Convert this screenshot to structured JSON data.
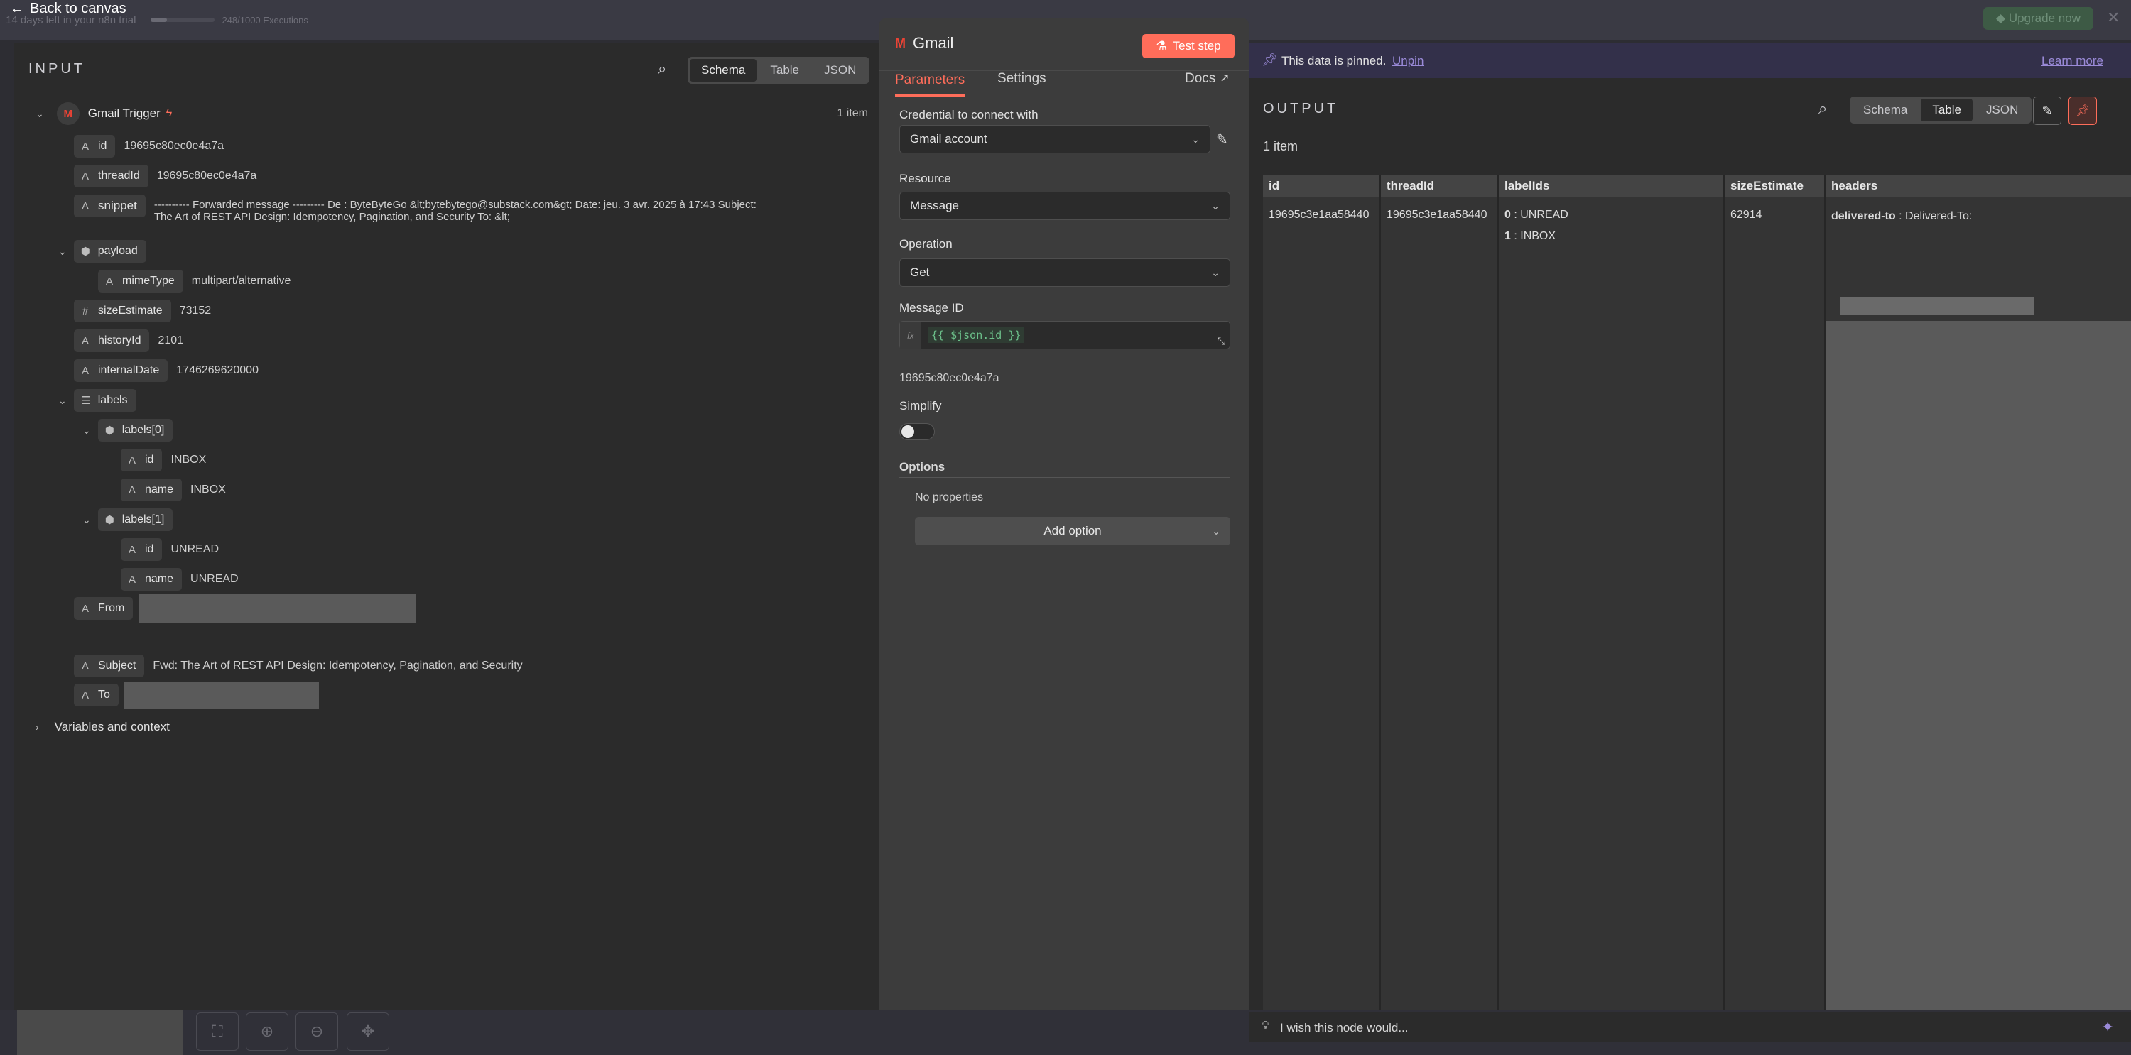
{
  "topbar": {
    "back_label": "Back to canvas",
    "trial_text": "14 days left in your n8n trial",
    "executions_text": "248/1000 Executions",
    "executions_progress": 0.248,
    "upgrade_label": "Upgrade now"
  },
  "input": {
    "title": "INPUT",
    "views": [
      "Schema",
      "Table",
      "JSON"
    ],
    "active_view": "Schema",
    "trigger_name": "Gmail Trigger",
    "item_count": "1 item",
    "fields": {
      "id": {
        "key": "id",
        "value": "19695c80ec0e4a7a"
      },
      "threadId": {
        "key": "threadId",
        "value": "19695c80ec0e4a7a"
      },
      "snippet": {
        "key": "snippet",
        "value_line1": "---------- Forwarded message --------- De : ByteByteGo &lt;bytebytego@substack.com&gt; Date: jeu. 3 avr. 2025 à 17:43 Subject:",
        "value_line2": "The Art of REST API Design: Idempotency, Pagination, and Security To: &lt;"
      },
      "payload": {
        "key": "payload"
      },
      "mimeType": {
        "key": "mimeType",
        "value": "multipart/alternative"
      },
      "sizeEstimate": {
        "key": "sizeEstimate",
        "value": "73152"
      },
      "historyId": {
        "key": "historyId",
        "value": "2101"
      },
      "internalDate": {
        "key": "internalDate",
        "value": "1746269620000"
      },
      "labels": {
        "key": "labels"
      },
      "labels0": {
        "key": "labels[0]",
        "id_key": "id",
        "id_value": "INBOX",
        "name_key": "name",
        "name_value": "INBOX"
      },
      "labels1": {
        "key": "labels[1]",
        "id_key": "id",
        "id_value": "UNREAD",
        "name_key": "name",
        "name_value": "UNREAD"
      },
      "from": {
        "key": "From"
      },
      "subject": {
        "key": "Subject",
        "value": "Fwd: The Art of REST API Design: Idempotency, Pagination, and Security"
      },
      "to": {
        "key": "To"
      }
    },
    "variables_label": "Variables and context"
  },
  "node": {
    "name": "Gmail",
    "test_step_label": "Test step",
    "tabs": [
      "Parameters",
      "Settings"
    ],
    "active_tab": "Parameters",
    "docs_label": "Docs",
    "credential_label": "Credential to connect with",
    "credential_value": "Gmail account",
    "resource_label": "Resource",
    "resource_value": "Message",
    "operation_label": "Operation",
    "operation_value": "Get",
    "message_id_label": "Message ID",
    "message_id_expr": "{{ $json.id }}",
    "message_id_resolved": "19695c80ec0e4a7a",
    "fx_label": "fx",
    "simplify_label": "Simplify",
    "simplify_on": false,
    "options_label": "Options",
    "no_properties": "No properties",
    "add_option_label": "Add option",
    "feedback_text": "I wish this node would..."
  },
  "output": {
    "pinned_text": "This data is pinned.",
    "unpin_label": "Unpin",
    "learn_more_label": "Learn more",
    "title": "OUTPUT",
    "views": [
      "Schema",
      "Table",
      "JSON"
    ],
    "active_view": "Table",
    "item_count": "1 item",
    "columns": [
      "id",
      "threadId",
      "labelIds",
      "sizeEstimate",
      "headers"
    ],
    "row": {
      "id": "19695c3e1aa58440",
      "threadId": "19695c3e1aa58440",
      "label0_index": "0",
      "label0_value": " : UNREAD",
      "label1_index": "1",
      "label1_value": " : INBOX",
      "sizeEstimate": "62914",
      "header_key": "delivered-to",
      "header_value": " : Delivered-To:"
    }
  },
  "colors": {
    "accent": "#ff6d5a",
    "pinned_bar": "#33304a",
    "pinned_text": "#9a8ad8"
  }
}
